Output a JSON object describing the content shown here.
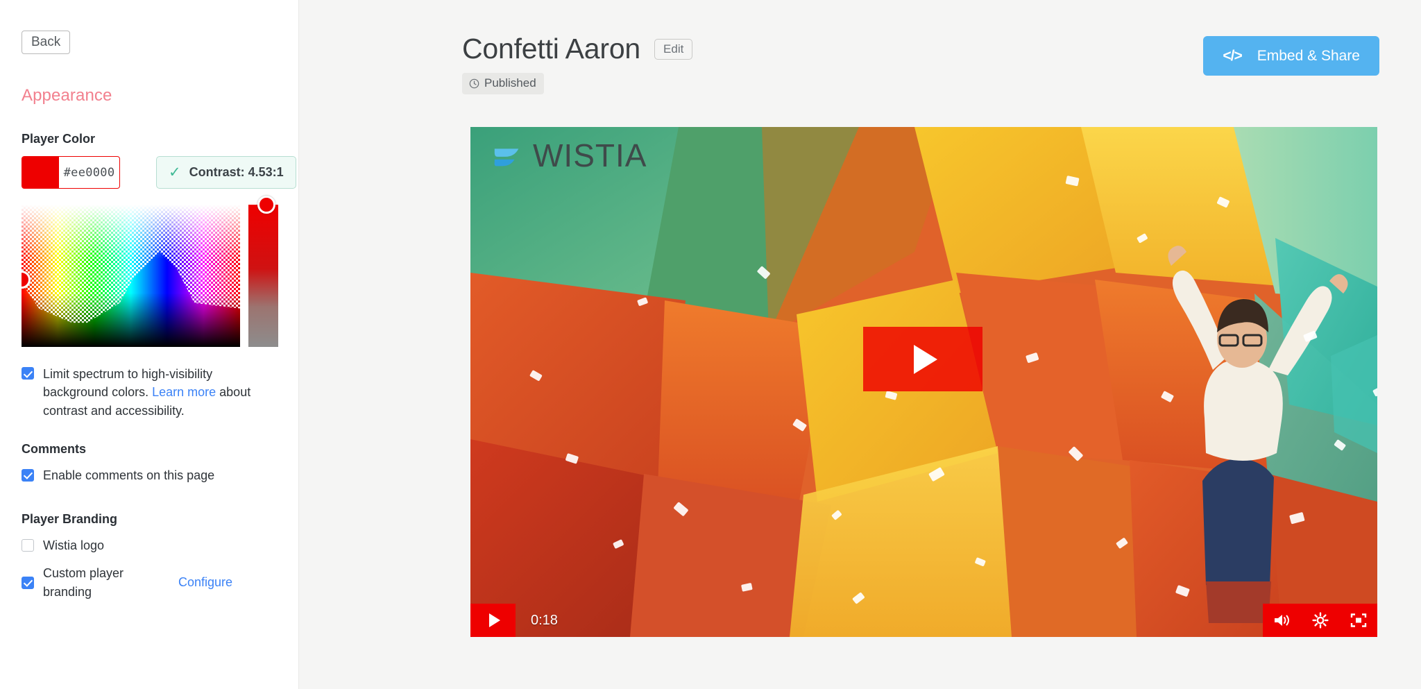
{
  "sidebar": {
    "back_label": "Back",
    "panel_title": "Appearance",
    "player_color": {
      "label": "Player Color",
      "hex_value": "#ee0000",
      "swatch_color": "#ee0000",
      "contrast_label": "Contrast: 4.53:1",
      "contrast_check_glyph": "✓",
      "contrast_accent": "#3fb995"
    },
    "limit_spectrum": {
      "checked": true,
      "text_before": "Limit spectrum to high-visibility background colors. ",
      "link_text": "Learn more",
      "text_after": " about contrast and accessibility."
    },
    "comments": {
      "label": "Comments",
      "enable_label": "Enable comments on this page",
      "enable_checked": true
    },
    "branding": {
      "label": "Player Branding",
      "wistia_logo_label": "Wistia logo",
      "wistia_logo_checked": false,
      "custom_branding_label": "Custom player branding",
      "custom_branding_checked": true,
      "configure_label": "Configure"
    },
    "link_color": "#3b82f6",
    "title_color": "#f2808e"
  },
  "header": {
    "title": "Confetti Aaron",
    "edit_label": "Edit",
    "status_label": "Published",
    "embed_label": "Embed & Share",
    "embed_icon": "</>",
    "embed_color": "#54b3f0"
  },
  "video": {
    "logo_text": "WISTIA",
    "duration": "0:18",
    "player_accent": "#ee0000",
    "icons": {
      "play": "play-icon",
      "volume": "volume-icon",
      "settings": "gear-icon",
      "fullscreen": "fullscreen-icon"
    }
  }
}
